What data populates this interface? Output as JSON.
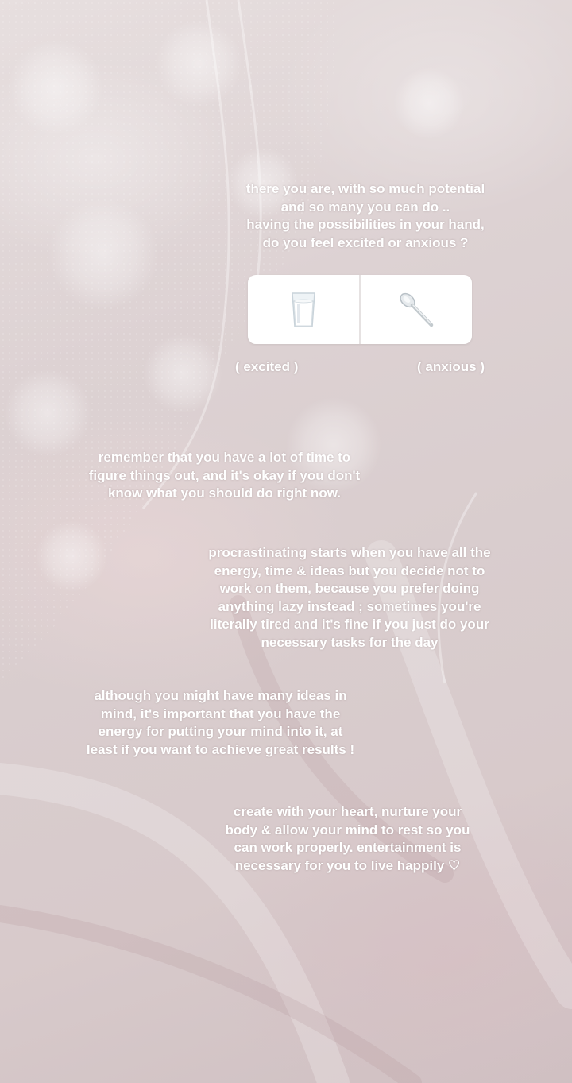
{
  "story": {
    "intro_text": "there you are, with so much potential\nand so many you can do ..\nhaving the possibilities in your hand,\ndo you feel excited or anxious ?",
    "quiz": {
      "options": [
        {
          "emoji": "🥛",
          "icon": "glass-of-milk-icon",
          "label": "( excited )"
        },
        {
          "emoji": "🥄",
          "icon": "spoon-icon",
          "label": "( anxious )"
        }
      ]
    },
    "paragraphs": [
      "remember that you have a lot of time to\nfigure things out, and it's okay if you don't\nknow what you should do right now.",
      "procrastinating starts when you have all the\nenergy, time & ideas but you decide not to\nwork on them, because you prefer doing\nanything lazy instead ; sometimes you're\nliterally tired and it's fine if you just do your\nnecessary tasks for the day",
      "although you might have many ideas in\nmind, it's important that you have the\nenergy for putting your mind into it, at\nleast if you want to achieve great results !",
      "create with your heart, nurture your\nbody & allow your mind to rest so you\ncan work properly. entertainment is\nnecessary for you to live happily ♡"
    ]
  },
  "colors": {
    "text": "#ffffff",
    "background": "#ddd2d3",
    "quiz_card": "#ffffff"
  }
}
